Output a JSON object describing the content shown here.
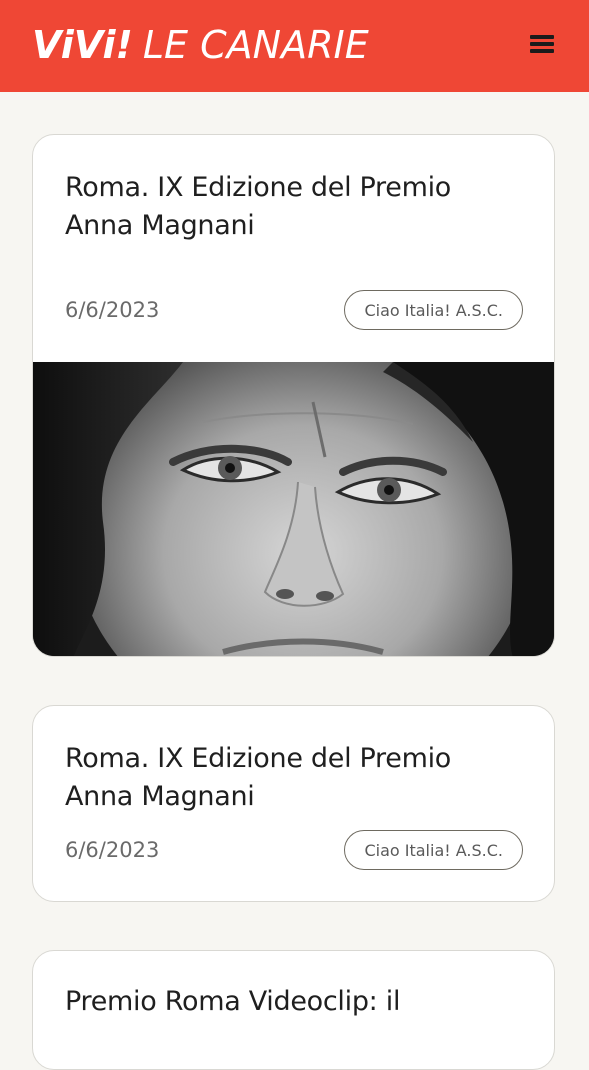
{
  "site": {
    "logo_bold": "ViVi!",
    "logo_light": "LE CANARIE",
    "menu_icon": "hamburger-menu-icon",
    "accent_color": "#ef4735"
  },
  "articles": [
    {
      "title": "Roma. IX Edizione del Premio Anna Magnani",
      "date": "6/6/2023",
      "tag": "Ciao Italia! A.S.C.",
      "has_image": true,
      "image_subject": "black-and-white close-up portrait photo"
    },
    {
      "title": "Roma. IX Edizione del Premio Anna Magnani",
      "date": "6/6/2023",
      "tag": "Ciao Italia! A.S.C.",
      "has_image": false
    },
    {
      "title": "Premio Roma Videoclip: il",
      "has_image": false
    }
  ]
}
